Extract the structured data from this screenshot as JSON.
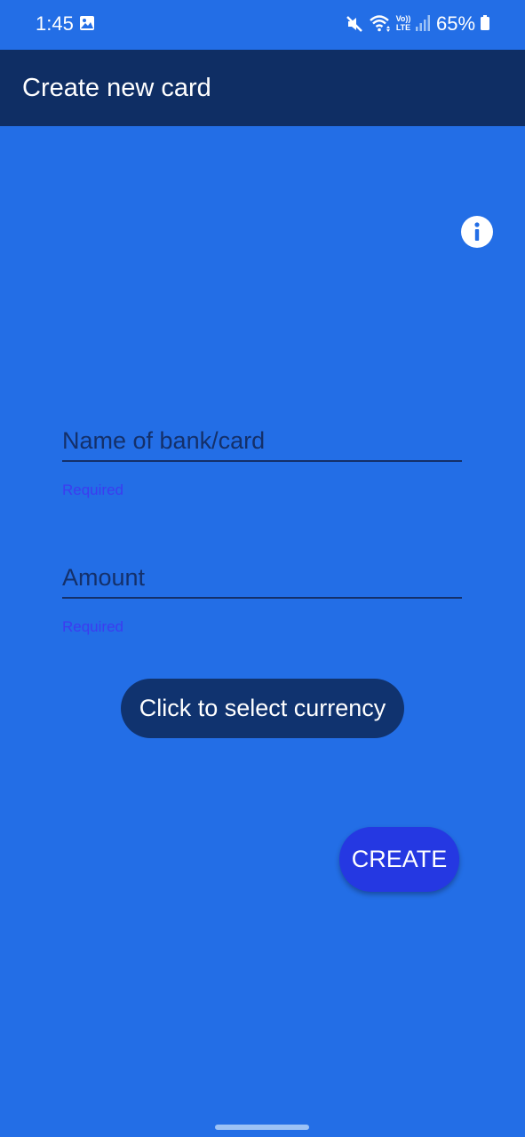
{
  "status_bar": {
    "time": "1:45",
    "volte_label": "Vo)) LTE",
    "battery": "65%"
  },
  "app_bar": {
    "title": "Create new card"
  },
  "form": {
    "name_field": {
      "placeholder": "Name of bank/card",
      "value": "",
      "helper": "Required"
    },
    "amount_field": {
      "placeholder": "Amount",
      "value": "",
      "helper": "Required"
    },
    "currency_button_label": "Click to select currency",
    "create_button_label": "CREATE"
  },
  "icons": {
    "info": "info-icon",
    "gallery": "gallery-icon",
    "mute": "mute-icon",
    "wifi": "wifi-icon",
    "signal": "signal-icon",
    "battery": "battery-icon"
  },
  "colors": {
    "background": "#236EE6",
    "app_bar": "#0F2E64",
    "currency_button": "#10336F",
    "create_button": "#2538E2",
    "helper_text": "#3C3CF0"
  }
}
